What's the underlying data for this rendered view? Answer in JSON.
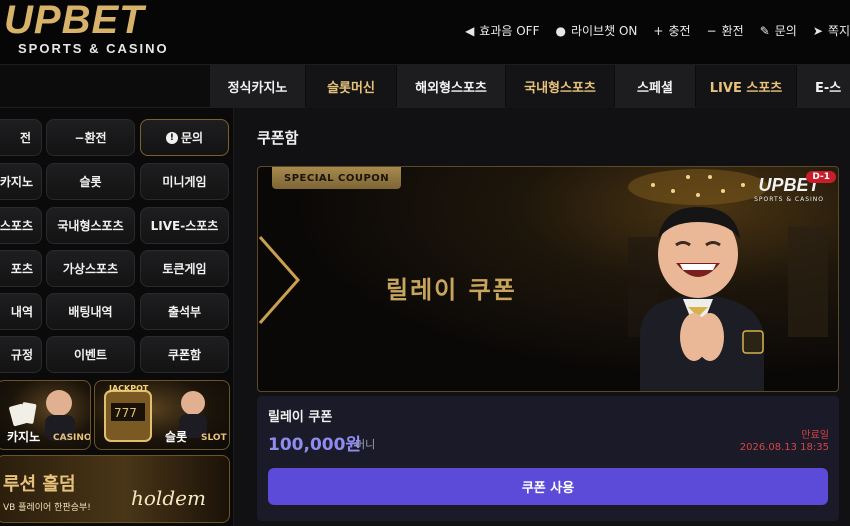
{
  "brand": {
    "name": "UPBET",
    "tagline": "SPORTS & CASINO"
  },
  "utilities": [
    {
      "icon": "speaker-icon",
      "glyph": "◀",
      "label": "효과음 OFF"
    },
    {
      "icon": "chat-icon",
      "glyph": "●",
      "label": "라이브챗 ON"
    },
    {
      "icon": "plus-icon",
      "glyph": "+",
      "label": "충전"
    },
    {
      "icon": "minus-icon",
      "glyph": "−",
      "label": "환전"
    },
    {
      "icon": "edit-icon",
      "glyph": "✎",
      "label": "문의"
    },
    {
      "icon": "send-icon",
      "glyph": "➤",
      "label": "쪽지"
    }
  ],
  "nav": [
    "정식카지노",
    "슬롯머신",
    "해외형스포츠",
    "국내형스포츠",
    "스페셜",
    "LIVE 스포츠",
    "E-스"
  ],
  "sidebar": {
    "buttons": [
      [
        "전",
        "환전",
        "문의"
      ],
      [
        "카지노",
        "슬롯",
        "미니게임"
      ],
      [
        "스포츠",
        "국내형스포츠",
        "LIVE-스포츠"
      ],
      [
        "포츠",
        "가상스포츠",
        "토큰게임"
      ],
      [
        "내역",
        "배팅내역",
        "출석부"
      ],
      [
        "규정",
        "이벤트",
        "쿠폰함"
      ]
    ],
    "promo_casino": {
      "label": "카지노",
      "sub": "CASINO"
    },
    "promo_slot": {
      "label": "슬롯",
      "sub": "SLOT",
      "badge": "JACKPOT"
    },
    "promo_holdem": {
      "title": "루션 홀덤",
      "sub": "VB 플레이어 한판승부!",
      "script": "holdem"
    }
  },
  "page": {
    "title": "쿠폰함"
  },
  "coupon": {
    "tag": "SPECIAL COUPON",
    "banner_title": "릴레이 쿠폰",
    "banner_logo": "UPBET",
    "banner_logo_sub": "SPORTS & CASINO",
    "day_badge": "D-1",
    "name": "릴레이 쿠폰",
    "amount": "100,000원",
    "unit": "머니",
    "expiry_label": "만료일",
    "expiry_date": "2026.08.13 18:35",
    "use_label": "쿠폰 사용"
  },
  "colors": {
    "accent": "#5c4ad8",
    "gold": "#d7b36a",
    "amount": "#8f8cf0",
    "expiry": "#d64545"
  }
}
